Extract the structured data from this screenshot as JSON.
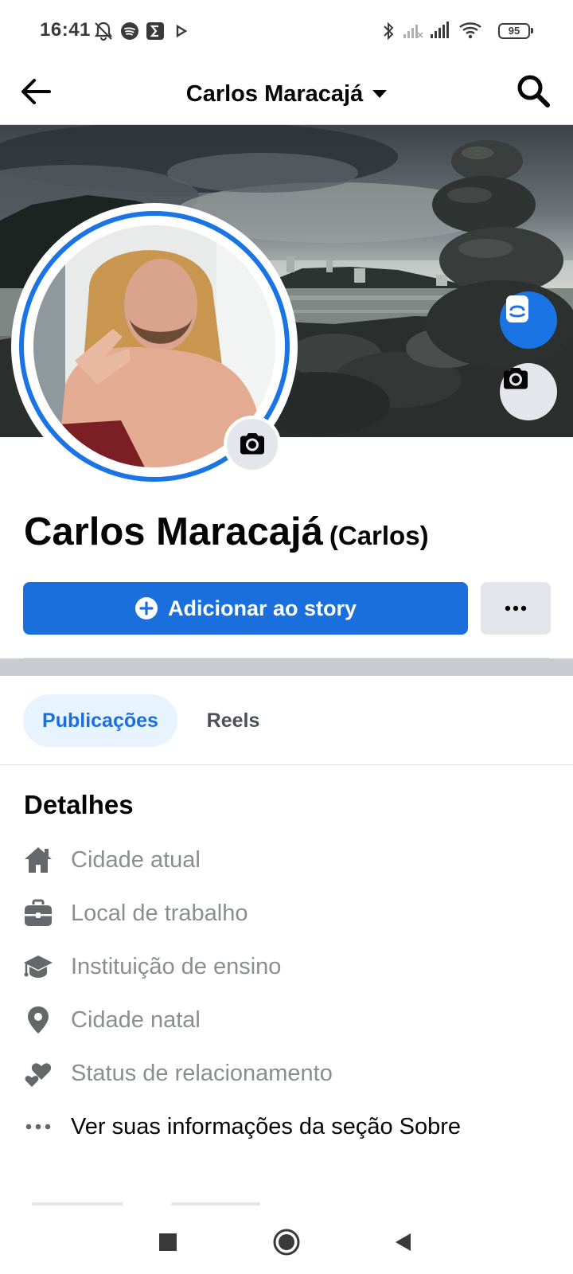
{
  "status_bar": {
    "time": "16:41",
    "icons": [
      "notifications-off-icon",
      "spotify-icon",
      "sigma-app-icon",
      "play-icon",
      "bluetooth-icon",
      "signal-off-icon",
      "signal-icon",
      "wifi-icon",
      "battery-icon"
    ],
    "battery": "95"
  },
  "header": {
    "title": "Carlos Maracajá",
    "back_icon": "arrow-left-icon",
    "search_icon": "search-icon"
  },
  "profile": {
    "name": "Carlos Maracajá",
    "nickname": "(Carlos)"
  },
  "actions": {
    "story_label": "Adicionar ao story",
    "story_icon": "plus-circle-icon",
    "more_icon": "more-dots-icon"
  },
  "tabs": [
    {
      "label": "Publicações",
      "active": true
    },
    {
      "label": "Reels",
      "active": false
    }
  ],
  "details": {
    "title": "Detalhes",
    "items": [
      {
        "icon": "home-icon",
        "label": "Cidade atual"
      },
      {
        "icon": "briefcase-icon",
        "label": "Local de trabalho"
      },
      {
        "icon": "graduation-cap-icon",
        "label": "Instituição de ensino"
      },
      {
        "icon": "location-pin-icon",
        "label": "Cidade natal"
      },
      {
        "icon": "hearts-icon",
        "label": "Status de relacionamento"
      },
      {
        "icon": "more-dots-icon",
        "label": "Ver suas informações da seção Sobre"
      }
    ]
  },
  "colors": {
    "accent": "#1b6fdd",
    "accent_light": "#e7f3ff",
    "secondary_button": "#e4e6eb",
    "muted_text": "#8a8d91",
    "icon_gray": "#65676b"
  },
  "nav": [
    "recents-square-icon",
    "home-circle-icon",
    "back-triangle-icon"
  ]
}
